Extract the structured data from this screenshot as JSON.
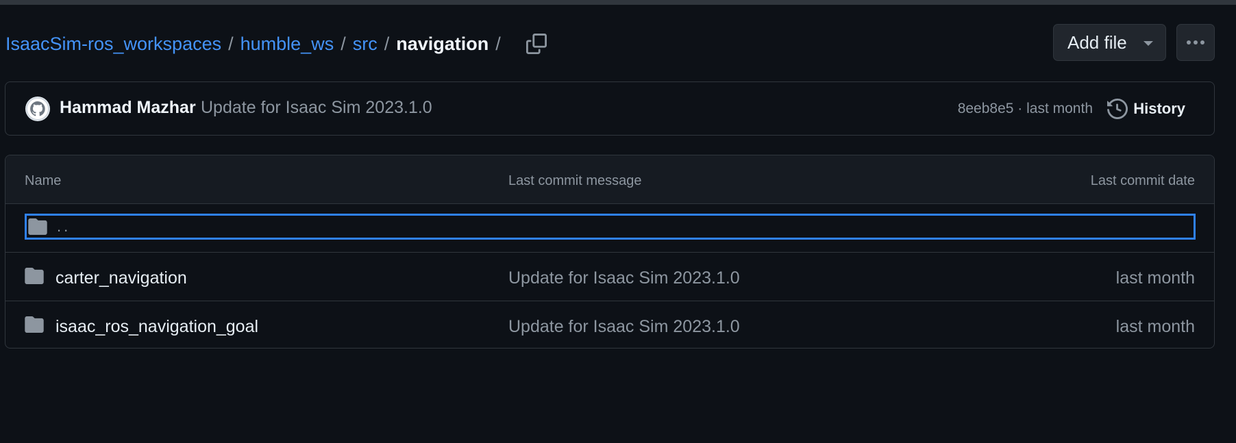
{
  "breadcrumb": {
    "repo": "IsaacSim-ros_workspaces",
    "path1": "humble_ws",
    "path2": "src",
    "current": "navigation",
    "separator": "/"
  },
  "toolbar": {
    "add_file_label": "Add file",
    "more_icon": "kebab-horizontal-icon",
    "copy_icon": "copy-icon"
  },
  "latest_commit": {
    "author": "Hammad Mazhar",
    "message": "Update for Isaac Sim 2023.1.0",
    "meta": "8eeb8e5 · last month",
    "history_label": "History"
  },
  "table": {
    "columns": {
      "name": "Name",
      "message": "Last commit message",
      "date": "Last commit date"
    },
    "parent_dir": "..",
    "rows": [
      {
        "name": "carter_navigation",
        "message": "Update for Isaac Sim 2023.1.0",
        "date": "last month"
      },
      {
        "name": "isaac_ros_navigation_goal",
        "message": "Update for Isaac Sim 2023.1.0",
        "date": "last month"
      }
    ]
  },
  "colors": {
    "background": "#0d1117",
    "link": "#4493f8",
    "muted": "#8d96a0",
    "border": "#30363d",
    "focus": "#2f81f7"
  }
}
